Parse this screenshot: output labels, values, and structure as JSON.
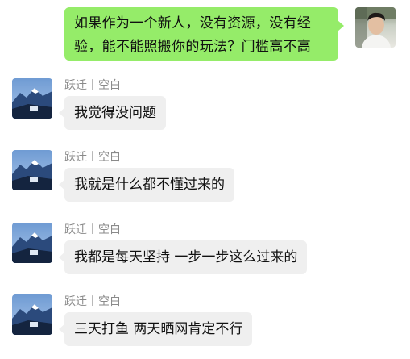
{
  "outgoing": {
    "text": "如果作为一个新人，没有资源，没有经验，能不能照搬你的玩法？门槛高不高",
    "bubble_color": "#95ec69"
  },
  "incoming": [
    {
      "sender": "跃迁丨空白",
      "text": "我觉得没问题"
    },
    {
      "sender": "跃迁丨空白",
      "text": "我就是什么都不懂过来的"
    },
    {
      "sender": "跃迁丨空白",
      "text": "我都是每天坚持 一步一步这么过来的"
    },
    {
      "sender": "跃迁丨空白",
      "text": "三天打鱼 两天晒网肯定不行"
    }
  ],
  "colors": {
    "incoming_bubble": "#efefef",
    "sender_name": "#8a8a8a"
  }
}
